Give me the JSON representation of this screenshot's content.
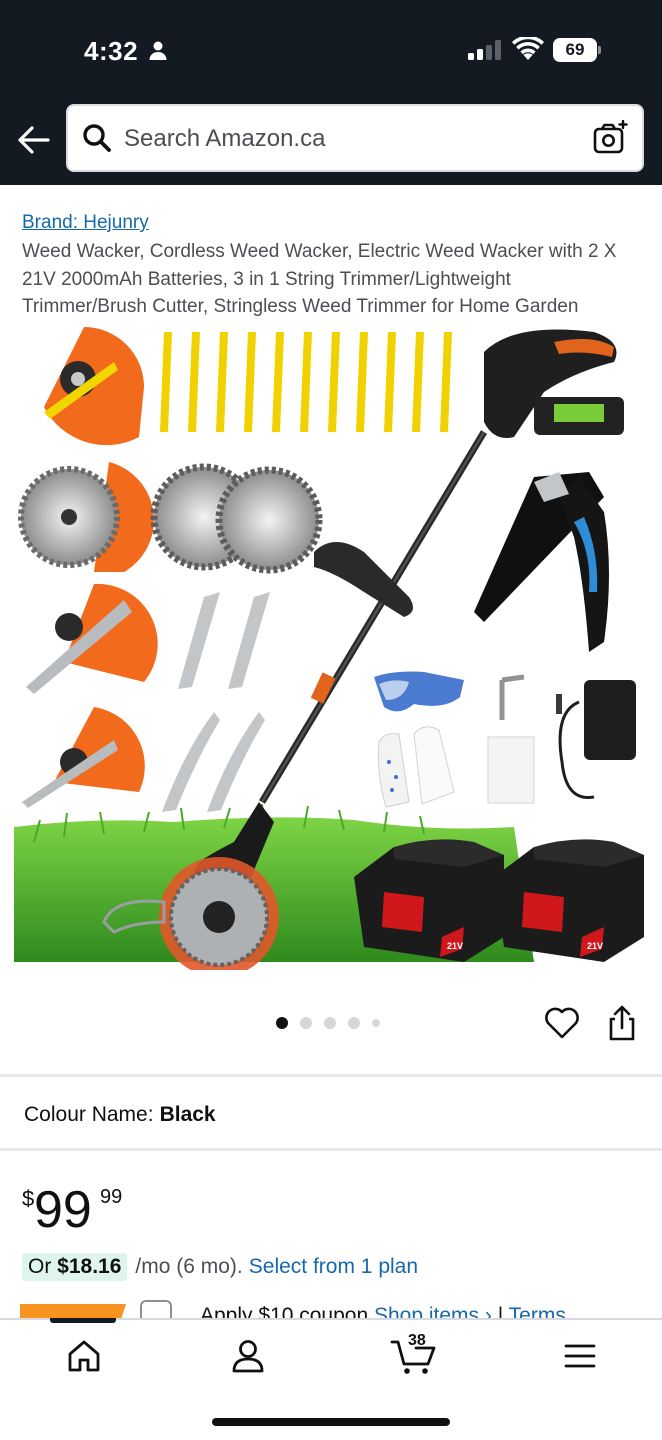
{
  "status_bar": {
    "time": "4:32",
    "battery": "69"
  },
  "search": {
    "placeholder": "Search Amazon.ca"
  },
  "product": {
    "brand": "Brand: Hejunry",
    "title": "Weed Wacker, Cordless Weed Wacker, Electric Weed Wacker with 2 X 21V 2000mAh Batteries, 3 in 1 String Trimmer/Lightweight Trimmer/Brush Cutter, Stringless Weed Trimmer for Home Garden",
    "battery_label": "21V"
  },
  "gallery": {
    "total": 5,
    "active_index": 0
  },
  "colour": {
    "label": "Colour Name:",
    "value": "Black"
  },
  "price": {
    "currency_symbol": "$",
    "whole": "99",
    "fraction": "99"
  },
  "plan": {
    "prefix": "Or",
    "monthly": "$18.16",
    "rest": "/mo (6 mo).",
    "link": "Select from 1 plan"
  },
  "coupon": {
    "text": "Apply $10 coupon",
    "link1": "Shop items ›",
    "separator": "|",
    "link2": "Terms"
  },
  "bottom_nav": {
    "cart_count": "38"
  },
  "colors": {
    "header_bg": "#131a22",
    "link": "#1669a9",
    "accent_orange": "#f7931e",
    "plan_pill_bg": "#dff5ec"
  },
  "icons": [
    "person-icon",
    "signal-icon",
    "wifi-icon",
    "back-arrow-icon",
    "search-icon",
    "camera-search-icon",
    "heart-icon",
    "share-icon",
    "home-icon",
    "account-icon",
    "cart-icon",
    "menu-icon"
  ]
}
